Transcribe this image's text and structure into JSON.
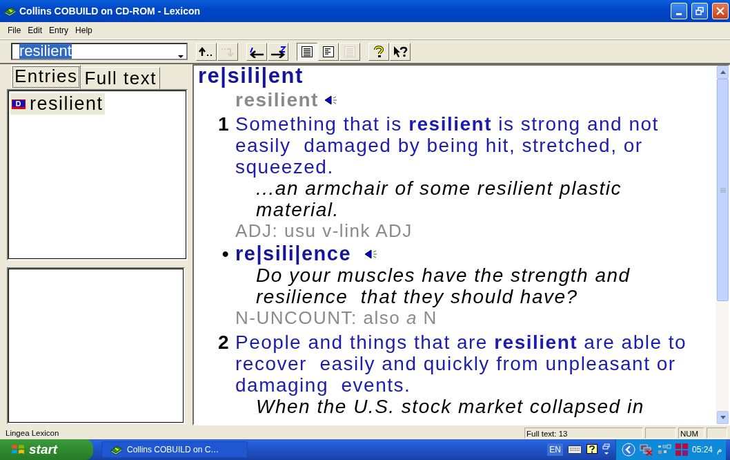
{
  "window": {
    "title": "Collins COBUILD on CD-ROM - Lexicon"
  },
  "menu": [
    "File",
    "Edit",
    "Entry",
    "Help"
  ],
  "search_field": {
    "value": "resilient"
  },
  "toolbar": [
    {
      "buttons": [
        {
          "kind": "up",
          "disabled": false,
          "pressed": false
        },
        {
          "kind": "down",
          "disabled": true,
          "pressed": false
        }
      ]
    },
    {
      "buttons": [
        {
          "kind": "prev",
          "disabled": false,
          "pressed": false
        },
        {
          "kind": "next",
          "disabled": false,
          "pressed": false
        }
      ]
    },
    {
      "buttons": [
        {
          "kind": "view-full",
          "disabled": false,
          "pressed": true
        },
        {
          "kind": "view-brief",
          "disabled": false,
          "pressed": false
        },
        {
          "kind": "view-plain",
          "disabled": true,
          "pressed": false
        }
      ]
    },
    {
      "buttons": [
        {
          "kind": "help",
          "disabled": false,
          "pressed": false
        },
        {
          "kind": "context-help",
          "disabled": false,
          "pressed": false
        }
      ]
    }
  ],
  "tabs": [
    {
      "label": "Entries",
      "selected": true
    },
    {
      "label": "Full text",
      "selected": false
    }
  ],
  "entries": [
    {
      "label": "resilient",
      "selected": true
    }
  ],
  "entry": {
    "headword": "re|sili|ent",
    "pronunciation": "resilient",
    "blocks": [
      {
        "kind": "sense",
        "number": "1",
        "text": "Something that is **resilient** is strong and not easily  damaged by being hit, stretched, or squeezed."
      },
      {
        "kind": "example",
        "text": "...an armchair of some resilient plastic material."
      },
      {
        "kind": "grammar",
        "text": "ADJ: usu v-link ADJ"
      },
      {
        "kind": "derived",
        "bullet": "•",
        "word": "re|sili|ence"
      },
      {
        "kind": "example",
        "text": "Do your muscles have the strength and resilience  that they should have?"
      },
      {
        "kind": "grammar",
        "text": "N-UNCOUNT: also *a* N"
      },
      {
        "kind": "sense",
        "number": "2",
        "text": "People and things that are **resilient** are able to recover  easily and quickly from unpleasant or damaging  events."
      },
      {
        "kind": "example",
        "text": "When the U.S. stock market collapsed in"
      }
    ]
  },
  "status_bar": {
    "text": "Lingea Lexicon",
    "fields": [
      "Full text: 13",
      "NUM"
    ]
  },
  "taskbar": {
    "start": "start",
    "task": "Collins COBUILD on C…",
    "language": "EN",
    "time": "05:24",
    "time_suffix": "م"
  }
}
